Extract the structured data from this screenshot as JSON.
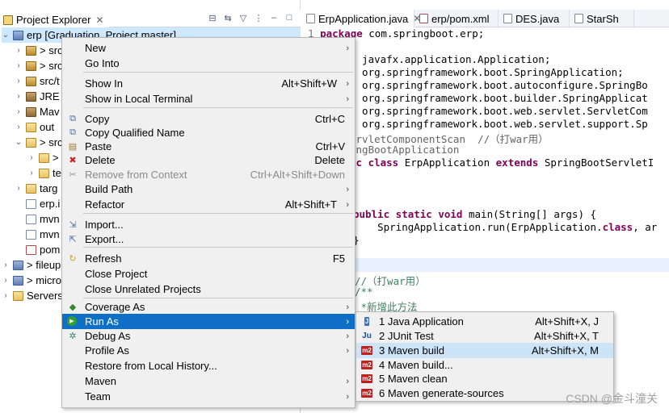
{
  "explorer": {
    "title": "Project Explorer",
    "close": "✕",
    "tree": [
      {
        "twisty": "⌄",
        "icon": "proj",
        "label": "erp [Graduation_Project master]",
        "indent": 0,
        "selected": true
      },
      {
        "twisty": "›",
        "icon": "pkg",
        "label": "> src",
        "indent": 1
      },
      {
        "twisty": "›",
        "icon": "pkg",
        "label": "> src",
        "indent": 1
      },
      {
        "twisty": "›",
        "icon": "pkg",
        "label": "src/t",
        "indent": 1
      },
      {
        "twisty": "›",
        "icon": "jar",
        "label": "JRE S",
        "indent": 1
      },
      {
        "twisty": "›",
        "icon": "jar",
        "label": "Mav",
        "indent": 1
      },
      {
        "twisty": "›",
        "icon": "folder",
        "label": "out",
        "indent": 1
      },
      {
        "twisty": "⌄",
        "icon": "folder",
        "label": "> src",
        "indent": 1
      },
      {
        "twisty": "›",
        "icon": "folder",
        "label": ">",
        "indent": 2
      },
      {
        "twisty": "›",
        "icon": "folder",
        "label": "te",
        "indent": 2
      },
      {
        "twisty": "›",
        "icon": "folder",
        "label": "targ",
        "indent": 1
      },
      {
        "twisty": "",
        "icon": "file",
        "label": "erp.i",
        "indent": 1
      },
      {
        "twisty": "",
        "icon": "file",
        "label": "mvn",
        "indent": 1
      },
      {
        "twisty": "",
        "icon": "file",
        "label": "mvn",
        "indent": 1
      },
      {
        "twisty": "",
        "icon": "xml",
        "label": "pom",
        "indent": 1
      },
      {
        "twisty": "›",
        "icon": "proj",
        "label": "> fileup",
        "indent": 0
      },
      {
        "twisty": "›",
        "icon": "proj",
        "label": "> micro",
        "indent": 0
      },
      {
        "twisty": "›",
        "icon": "folder",
        "label": "Servers",
        "indent": 0
      }
    ]
  },
  "editor": {
    "tabs": [
      {
        "label": "ErpApplication.java",
        "close": "✕",
        "active": true
      },
      {
        "label": "erp/pom.xml",
        "active": false
      },
      {
        "label": "DES.java",
        "active": false
      },
      {
        "label": "StarSh",
        "active": false
      }
    ],
    "lines": [
      {
        "no": "1",
        "html_parts": [
          {
            "t": "package",
            "c": "kw"
          },
          {
            "t": " com.springboot.erp;",
            "c": ""
          }
        ]
      },
      {
        "no": "",
        "html_parts": []
      },
      {
        "no": "",
        "html_parts": [
          {
            "t": "t",
            "c": "kw"
          },
          {
            "t": " javafx.application.Application;",
            "c": ""
          }
        ]
      },
      {
        "no": "",
        "html_parts": [
          {
            "t": "t",
            "c": "kw"
          },
          {
            "t": " org.springframework.boot.SpringApplication;",
            "c": ""
          }
        ]
      },
      {
        "no": "",
        "html_parts": [
          {
            "t": "t",
            "c": "kw"
          },
          {
            "t": " org.springframework.boot.autoconfigure.SpringBo",
            "c": ""
          }
        ]
      },
      {
        "no": "",
        "html_parts": [
          {
            "t": "t",
            "c": "kw"
          },
          {
            "t": " org.springframework.boot.builder.SpringApplicat",
            "c": ""
          }
        ]
      },
      {
        "no": "",
        "html_parts": [
          {
            "t": "t",
            "c": "kw"
          },
          {
            "t": " org.springframework.boot.web.servlet.ServletCom",
            "c": ""
          }
        ]
      },
      {
        "no": "",
        "html_parts": [
          {
            "t": "t",
            "c": "kw"
          },
          {
            "t": " org.springframework.boot.web.servlet.support.Sp",
            "c": ""
          }
        ]
      },
      {
        "no": "",
        "html_parts": [
          {
            "t": "ervletComponentScan  //（打war用）",
            "c": "an"
          }
        ]
      },
      {
        "no": "",
        "html_parts": [
          {
            "t": "ingBootApplication",
            "c": "an"
          }
        ]
      },
      {
        "no": "",
        "html_parts": [
          {
            "t": "ic class",
            "c": "kw"
          },
          {
            "t": " ErpApplication ",
            "c": ""
          },
          {
            "t": "extends",
            "c": "kw"
          },
          {
            "t": " SpringBootServletI",
            "c": ""
          }
        ]
      },
      {
        "no": "",
        "html_parts": []
      },
      {
        "no": "",
        "html_parts": []
      },
      {
        "no": "",
        "html_parts": []
      },
      {
        "no": "",
        "html_parts": [
          {
            "t": "public static void",
            "c": "kw"
          },
          {
            "t": " main(String[] args) {",
            "c": ""
          }
        ]
      },
      {
        "no": "",
        "html_parts": [
          {
            "t": "    SpringApplication.run(ErpApplication.",
            "c": ""
          },
          {
            "t": "class",
            "c": "kw"
          },
          {
            "t": ", ar",
            "c": ""
          }
        ]
      },
      {
        "no": "",
        "html_parts": [
          {
            "t": "}",
            "c": ""
          }
        ]
      },
      {
        "no": "",
        "html_parts": []
      },
      {
        "no": "",
        "html_parts": []
      },
      {
        "no": "",
        "html_parts": [
          {
            "t": "//（打war用）",
            "c": "cm"
          }
        ]
      },
      {
        "no": "",
        "html_parts": [
          {
            "t": "/**",
            "c": "cm"
          }
        ]
      },
      {
        "no": "",
        "html_parts": [
          {
            "t": " *新增此方法",
            "c": "cm"
          }
        ]
      },
      {
        "no": "",
        "html_parts": []
      },
      {
        "no": "",
        "html_parts": []
      },
      {
        "no": "",
        "html_parts": [
          {
            "t": "                            (Sprin",
            "c": ""
          }
        ]
      },
      {
        "no": "",
        "html_parts": [
          {
            "t": "                            cation",
            "c": ""
          }
        ]
      },
      {
        "no": "",
        "html_parts": [
          {
            "t": "                            lass);",
            "c": ""
          }
        ]
      }
    ]
  },
  "context_menu": {
    "items": [
      {
        "label": "New",
        "shortcut": "",
        "submenu": true,
        "icon": ""
      },
      {
        "label": "Go Into",
        "shortcut": "",
        "submenu": false,
        "icon": ""
      },
      {
        "sep": true
      },
      {
        "label": "Show In",
        "shortcut": "Alt+Shift+W",
        "submenu": true,
        "icon": ""
      },
      {
        "label": "Show in Local Terminal",
        "shortcut": "",
        "submenu": true,
        "icon": ""
      },
      {
        "sep": true
      },
      {
        "label": "Copy",
        "shortcut": "Ctrl+C",
        "submenu": false,
        "icon": "copy-icon"
      },
      {
        "label": "Copy Qualified Name",
        "shortcut": "",
        "submenu": false,
        "icon": "copy-qualified-icon"
      },
      {
        "label": "Paste",
        "shortcut": "Ctrl+V",
        "submenu": false,
        "icon": "paste-icon"
      },
      {
        "label": "Delete",
        "shortcut": "Delete",
        "submenu": false,
        "icon": "delete-icon"
      },
      {
        "label": "Remove from Context",
        "shortcut": "Ctrl+Alt+Shift+Down",
        "submenu": false,
        "icon": "remove-context-icon",
        "disabled": true
      },
      {
        "label": "Build Path",
        "shortcut": "",
        "submenu": true,
        "icon": ""
      },
      {
        "label": "Refactor",
        "shortcut": "Alt+Shift+T",
        "submenu": true,
        "icon": ""
      },
      {
        "sep": true
      },
      {
        "label": "Import...",
        "shortcut": "",
        "submenu": false,
        "icon": "import-icon"
      },
      {
        "label": "Export...",
        "shortcut": "",
        "submenu": false,
        "icon": "export-icon"
      },
      {
        "sep": true
      },
      {
        "label": "Refresh",
        "shortcut": "F5",
        "submenu": false,
        "icon": "refresh-icon"
      },
      {
        "label": "Close Project",
        "shortcut": "",
        "submenu": false,
        "icon": ""
      },
      {
        "label": "Close Unrelated Projects",
        "shortcut": "",
        "submenu": false,
        "icon": ""
      },
      {
        "sep": true
      },
      {
        "label": "Coverage As",
        "shortcut": "",
        "submenu": true,
        "icon": "coverage-icon"
      },
      {
        "label": "Run As",
        "shortcut": "",
        "submenu": true,
        "icon": "run-icon",
        "hover": true
      },
      {
        "label": "Debug As",
        "shortcut": "",
        "submenu": true,
        "icon": "debug-icon"
      },
      {
        "label": "Profile As",
        "shortcut": "",
        "submenu": true,
        "icon": ""
      },
      {
        "label": "Restore from Local History...",
        "shortcut": "",
        "submenu": false,
        "icon": ""
      },
      {
        "label": "Maven",
        "shortcut": "",
        "submenu": true,
        "icon": ""
      },
      {
        "label": "Team",
        "shortcut": "",
        "submenu": true,
        "icon": ""
      }
    ]
  },
  "run_as_submenu": {
    "items": [
      {
        "label": "1 Java Application",
        "shortcut": "Alt+Shift+X, J",
        "badge": "J",
        "badge_class": "ja",
        "icon": "java-app-icon"
      },
      {
        "label": "2 JUnit Test",
        "shortcut": "Alt+Shift+X, T",
        "badge": "Ju",
        "badge_class": "ju",
        "icon": "junit-icon"
      },
      {
        "label": "3 Maven build",
        "shortcut": "Alt+Shift+X, M",
        "badge": "m2",
        "badge_class": "m2",
        "icon": "maven-icon",
        "hover": true
      },
      {
        "label": "4 Maven build...",
        "shortcut": "",
        "badge": "m2",
        "badge_class": "m2",
        "icon": "maven-icon"
      },
      {
        "label": "5 Maven clean",
        "shortcut": "",
        "badge": "m2",
        "badge_class": "m2",
        "icon": "maven-icon"
      },
      {
        "label": "6 Maven generate-sources",
        "shortcut": "",
        "badge": "m2",
        "badge_class": "m2",
        "icon": "maven-icon"
      }
    ]
  },
  "watermark": "CSDN @金斗潼关",
  "colors": {
    "menu_hover": "#0f6fc6",
    "submenu_hover": "#cce4f7",
    "keyword": "#7f0055",
    "comment": "#3f7f5f"
  }
}
